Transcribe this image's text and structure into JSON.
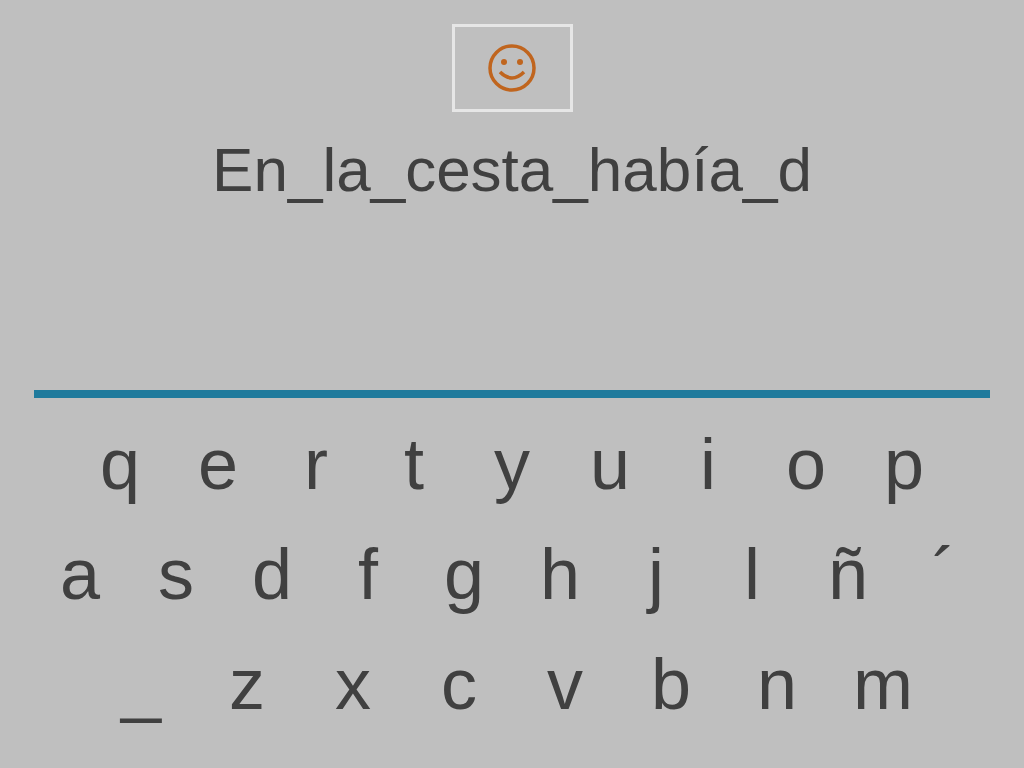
{
  "sentence": "En_la_cesta_había_d",
  "keyboard": {
    "rows": [
      [
        "q",
        "e",
        "r",
        "t",
        "y",
        "u",
        "i",
        "o",
        "p"
      ],
      [
        "a",
        "s",
        "d",
        "f",
        "g",
        "h",
        "j",
        "l",
        "ñ",
        "´"
      ],
      [
        "_",
        "z",
        "x",
        "c",
        "v",
        "b",
        "n",
        "m"
      ]
    ]
  }
}
